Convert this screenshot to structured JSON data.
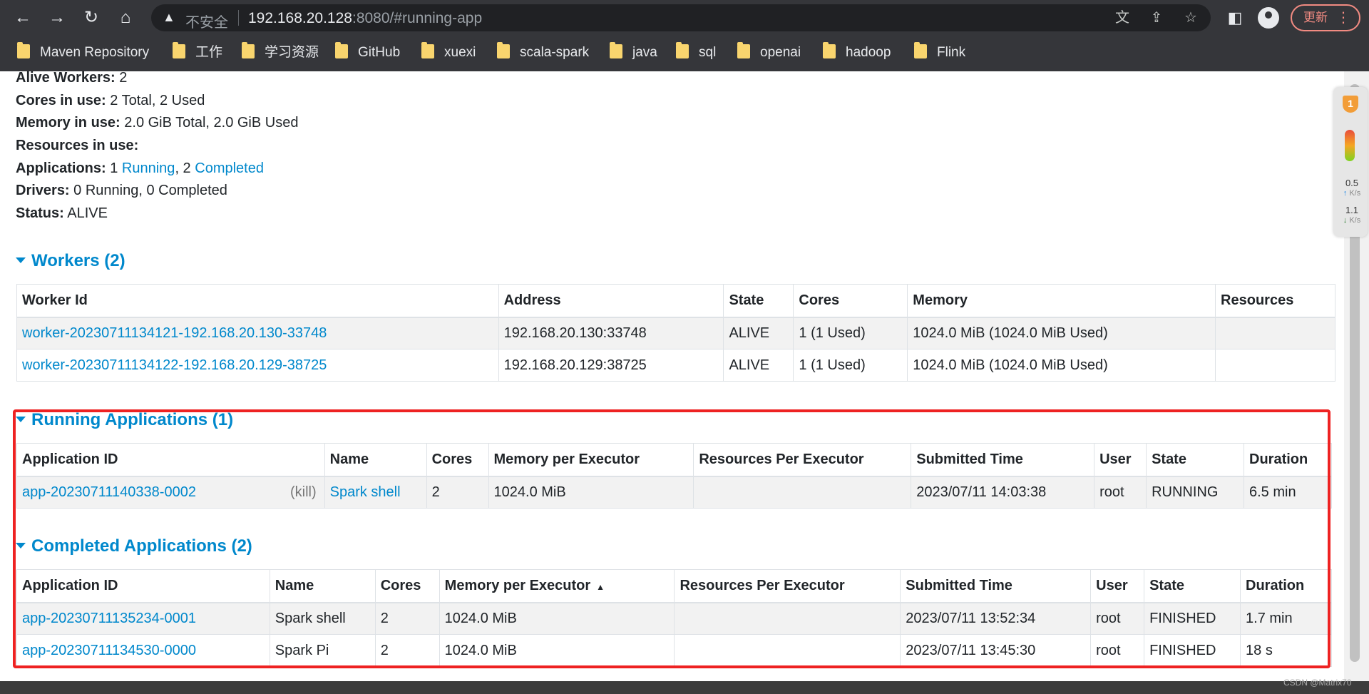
{
  "browser": {
    "insecure_label": "不安全",
    "url_host": "192.168.20.128",
    "url_rest": ":8080/#running-app",
    "update_label": "更新",
    "bookmarks": [
      "Maven Repository",
      "工作",
      "学习资源",
      "GitHub",
      "xuexi",
      "scala-spark",
      "java",
      "sql",
      "openai",
      "hadoop",
      "Flink"
    ]
  },
  "summary": {
    "alive_workers_label": "Alive Workers:",
    "alive_workers_value": "2",
    "cores_label": "Cores in use:",
    "cores_value": "2 Total, 2 Used",
    "memory_label": "Memory in use:",
    "memory_value": "2.0 GiB Total, 2.0 GiB Used",
    "resources_label": "Resources in use:",
    "applications_label": "Applications:",
    "applications_running_count": "1",
    "applications_running_link": "Running",
    "applications_sep": ", 2",
    "applications_completed_link": "Completed",
    "drivers_label": "Drivers:",
    "drivers_value": "0 Running, 0 Completed",
    "status_label": "Status:",
    "status_value": "ALIVE"
  },
  "workers": {
    "title": "Workers (2)",
    "headers": [
      "Worker Id",
      "Address",
      "State",
      "Cores",
      "Memory",
      "Resources"
    ],
    "rows": [
      [
        "worker-20230711134121-192.168.20.130-33748",
        "192.168.20.130:33748",
        "ALIVE",
        "1 (1 Used)",
        "1024.0 MiB (1024.0 MiB Used)",
        ""
      ],
      [
        "worker-20230711134122-192.168.20.129-38725",
        "192.168.20.129:38725",
        "ALIVE",
        "1 (1 Used)",
        "1024.0 MiB (1024.0 MiB Used)",
        ""
      ]
    ]
  },
  "running_apps": {
    "title": "Running Applications (1)",
    "headers": [
      "Application ID",
      "Name",
      "Cores",
      "Memory per Executor",
      "Resources Per Executor",
      "Submitted Time",
      "User",
      "State",
      "Duration"
    ],
    "kill_label": "(kill)",
    "rows": [
      [
        "app-20230711140338-0002",
        "Spark shell",
        "2",
        "1024.0 MiB",
        "",
        "2023/07/11 14:03:38",
        "root",
        "RUNNING",
        "6.5 min"
      ]
    ]
  },
  "completed_apps": {
    "title": "Completed Applications (2)",
    "headers": [
      "Application ID",
      "Name",
      "Cores",
      "Memory per Executor",
      "Resources Per Executor",
      "Submitted Time",
      "User",
      "State",
      "Duration"
    ],
    "sort_indicator": "▲",
    "rows": [
      [
        "app-20230711135234-0001",
        "Spark shell",
        "2",
        "1024.0 MiB",
        "",
        "2023/07/11 13:52:34",
        "root",
        "FINISHED",
        "1.7 min"
      ],
      [
        "app-20230711134530-0000",
        "Spark Pi",
        "2",
        "1024.0 MiB",
        "",
        "2023/07/11 13:45:30",
        "root",
        "FINISHED",
        "18 s"
      ]
    ]
  },
  "net_widget": {
    "badge": "1",
    "up_value": "0.5",
    "up_unit": "K/s",
    "down_value": "1.1",
    "down_unit": "K/s"
  },
  "watermark": "CSDN @Matrix70",
  "colors": {
    "link": "#0088cc",
    "highlight_box": "#ee2222",
    "chrome_bg": "#35363a"
  }
}
